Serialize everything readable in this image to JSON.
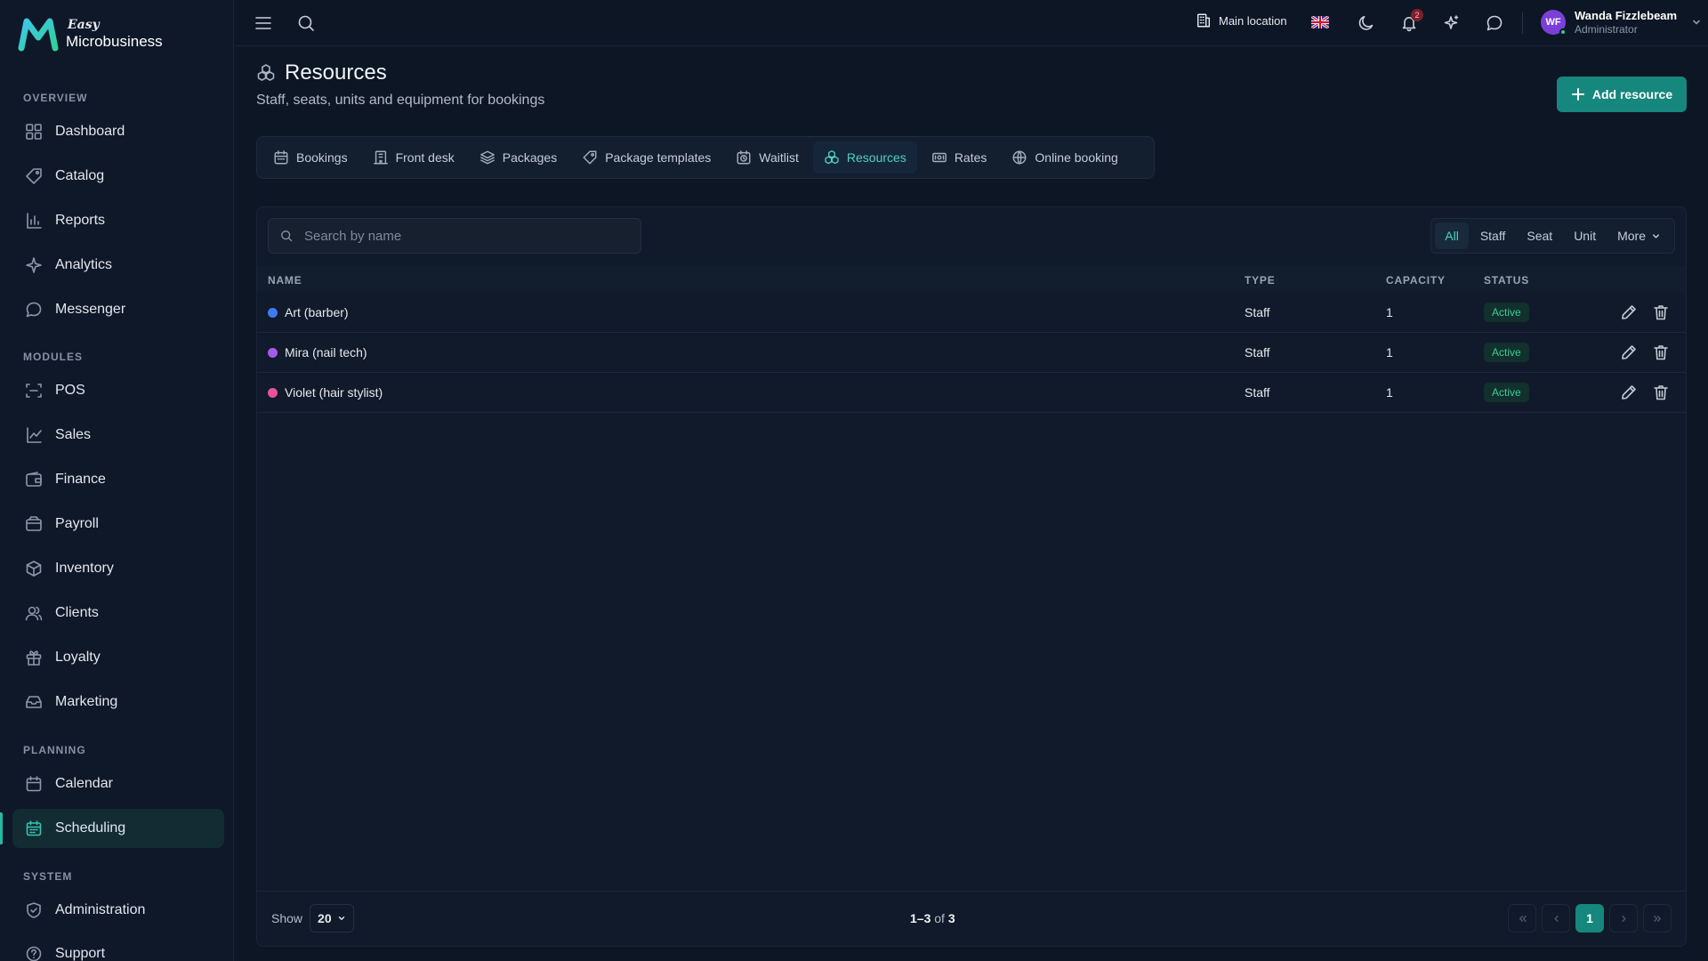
{
  "brand": {
    "top": "Easy",
    "name": "Microbusiness"
  },
  "colors": {
    "accent": "#16877c",
    "accent_text": "#4fd1c0",
    "status_active": "#3ccc98",
    "background": "#0d1625"
  },
  "sidebar": {
    "sections": [
      {
        "label": "OVERVIEW",
        "items": [
          {
            "label": "Dashboard",
            "icon": "dashboard-icon"
          },
          {
            "label": "Catalog",
            "icon": "catalog-icon"
          },
          {
            "label": "Reports",
            "icon": "reports-icon"
          },
          {
            "label": "Analytics",
            "icon": "analytics-icon"
          },
          {
            "label": "Messenger",
            "icon": "messenger-icon"
          }
        ]
      },
      {
        "label": "MODULES",
        "items": [
          {
            "label": "POS",
            "icon": "pos-icon"
          },
          {
            "label": "Sales",
            "icon": "sales-icon"
          },
          {
            "label": "Finance",
            "icon": "finance-icon"
          },
          {
            "label": "Payroll",
            "icon": "payroll-icon"
          },
          {
            "label": "Inventory",
            "icon": "inventory-icon"
          },
          {
            "label": "Clients",
            "icon": "clients-icon"
          },
          {
            "label": "Loyalty",
            "icon": "loyalty-icon"
          },
          {
            "label": "Marketing",
            "icon": "marketing-icon"
          }
        ]
      },
      {
        "label": "PLANNING",
        "items": [
          {
            "label": "Calendar",
            "icon": "calendar-icon"
          },
          {
            "label": "Scheduling",
            "icon": "scheduling-icon",
            "active": true
          }
        ]
      },
      {
        "label": "SYSTEM",
        "items": [
          {
            "label": "Administration",
            "icon": "administration-icon"
          },
          {
            "label": "Support",
            "icon": "support-icon"
          }
        ]
      }
    ]
  },
  "topbar": {
    "location": "Main location",
    "notifications_count": "2",
    "user": {
      "initials": "WF",
      "name": "Wanda Fizzlebeam",
      "role": "Administrator"
    }
  },
  "header": {
    "title": "Resources",
    "subtitle": "Staff, seats, units and equipment for bookings",
    "add_label": "Add resource"
  },
  "tabs": [
    {
      "label": "Bookings",
      "icon": "calendar-icon"
    },
    {
      "label": "Front desk",
      "icon": "front-desk-icon"
    },
    {
      "label": "Packages",
      "icon": "layers-icon"
    },
    {
      "label": "Package templates",
      "icon": "tag-icon"
    },
    {
      "label": "Waitlist",
      "icon": "waitlist-icon"
    },
    {
      "label": "Resources",
      "icon": "resources-icon",
      "active": true
    },
    {
      "label": "Rates",
      "icon": "rates-icon"
    },
    {
      "label": "Online booking",
      "icon": "globe-icon"
    }
  ],
  "search": {
    "placeholder": "Search by name",
    "value": ""
  },
  "filters": {
    "options": [
      "All",
      "Staff",
      "Seat",
      "Unit"
    ],
    "selected": "All",
    "more_label": "More"
  },
  "table": {
    "columns": {
      "name": "NAME",
      "type": "TYPE",
      "capacity": "CAPACITY",
      "status": "STATUS"
    },
    "rows": [
      {
        "name": "Art (barber)",
        "color": "#3d7bf0",
        "type": "Staff",
        "capacity": "1",
        "status": "Active"
      },
      {
        "name": "Mira (nail tech)",
        "color": "#a45be8",
        "type": "Staff",
        "capacity": "1",
        "status": "Active"
      },
      {
        "name": "Violet (hair stylist)",
        "color": "#e8519b",
        "type": "Staff",
        "capacity": "1",
        "status": "Active"
      }
    ]
  },
  "footer": {
    "show_label": "Show",
    "page_size": "20",
    "range": "1–3",
    "of_label": "of",
    "total": "3",
    "current_page": "1"
  }
}
